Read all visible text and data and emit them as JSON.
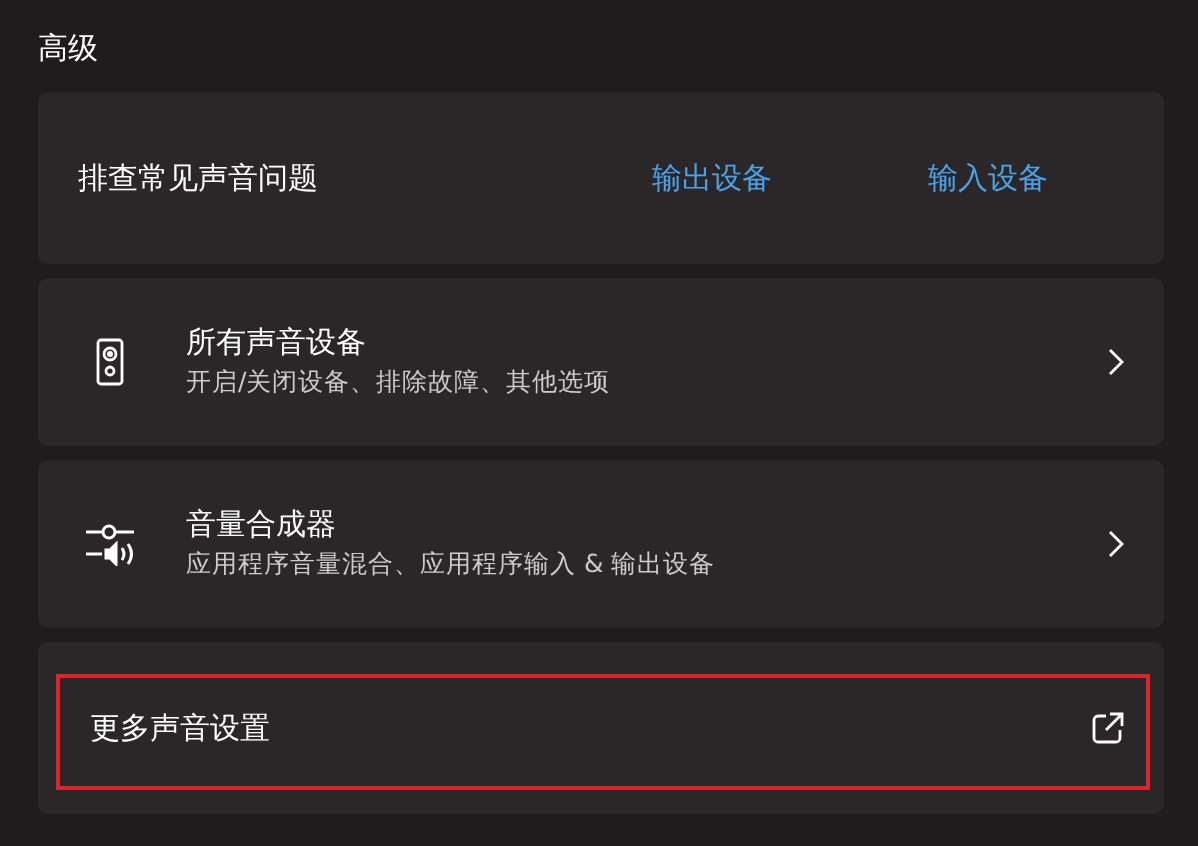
{
  "section_title": "高级",
  "cards": [
    {
      "kind": "links",
      "title": "排查常见声音问题",
      "links": [
        "输出设备",
        "输入设备"
      ]
    },
    {
      "kind": "nav",
      "title": "所有声音设备",
      "subtitle": "开启/关闭设备、排除故障、其他选项"
    },
    {
      "kind": "nav",
      "title": "音量合成器",
      "subtitle": "应用程序音量混合、应用程序输入 & 输出设备"
    },
    {
      "kind": "external",
      "title": "更多声音设置",
      "highlighted": true
    }
  ]
}
